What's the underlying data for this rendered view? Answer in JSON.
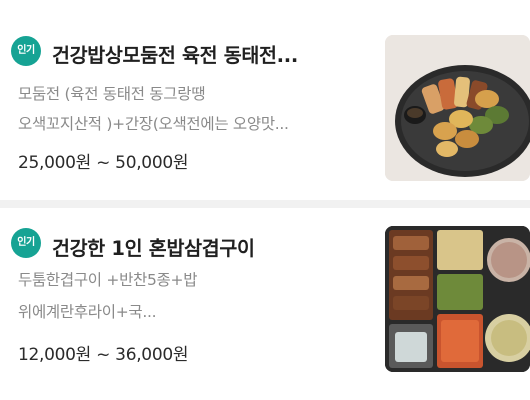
{
  "items": [
    {
      "badge": "인기",
      "title": "건강밥상모둠전  육전  동태전...",
      "desc_line1": "모둠전 (육전 동태전  동그랑땡",
      "desc_line2": "오색꼬지산적 )+간장(오색전에는 오양맛...",
      "price": "25,000원 ~ 50,000원",
      "image_icon": "jeon-platter-photo"
    },
    {
      "badge": "인기",
      "title": "건강한  1인 혼밥삼겹구이",
      "desc_line1": "두툼한겹구이 +반찬5종+밥",
      "desc_line2": "위에계란후라이+국...",
      "price": "12,000원 ~ 36,000원",
      "image_icon": "pork-belly-lunchbox-photo"
    }
  ],
  "colors": {
    "badge": "#16a394",
    "divider": "#f1f1f1",
    "title": "#202020",
    "desc": "#8a8a8a"
  }
}
